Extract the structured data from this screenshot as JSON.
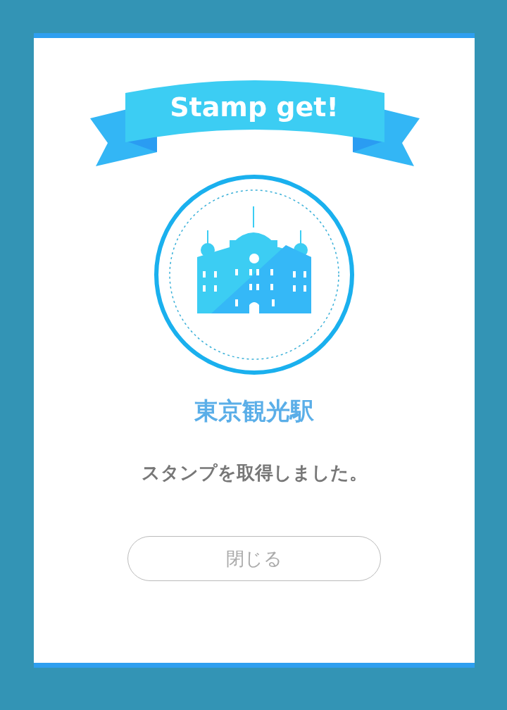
{
  "banner": {
    "title": "Stamp get!"
  },
  "stamp": {
    "station_name": "東京観光駅",
    "message": "スタンプを取得しました。"
  },
  "buttons": [
    {
      "label": "閉じる",
      "kind": "close"
    }
  ]
}
